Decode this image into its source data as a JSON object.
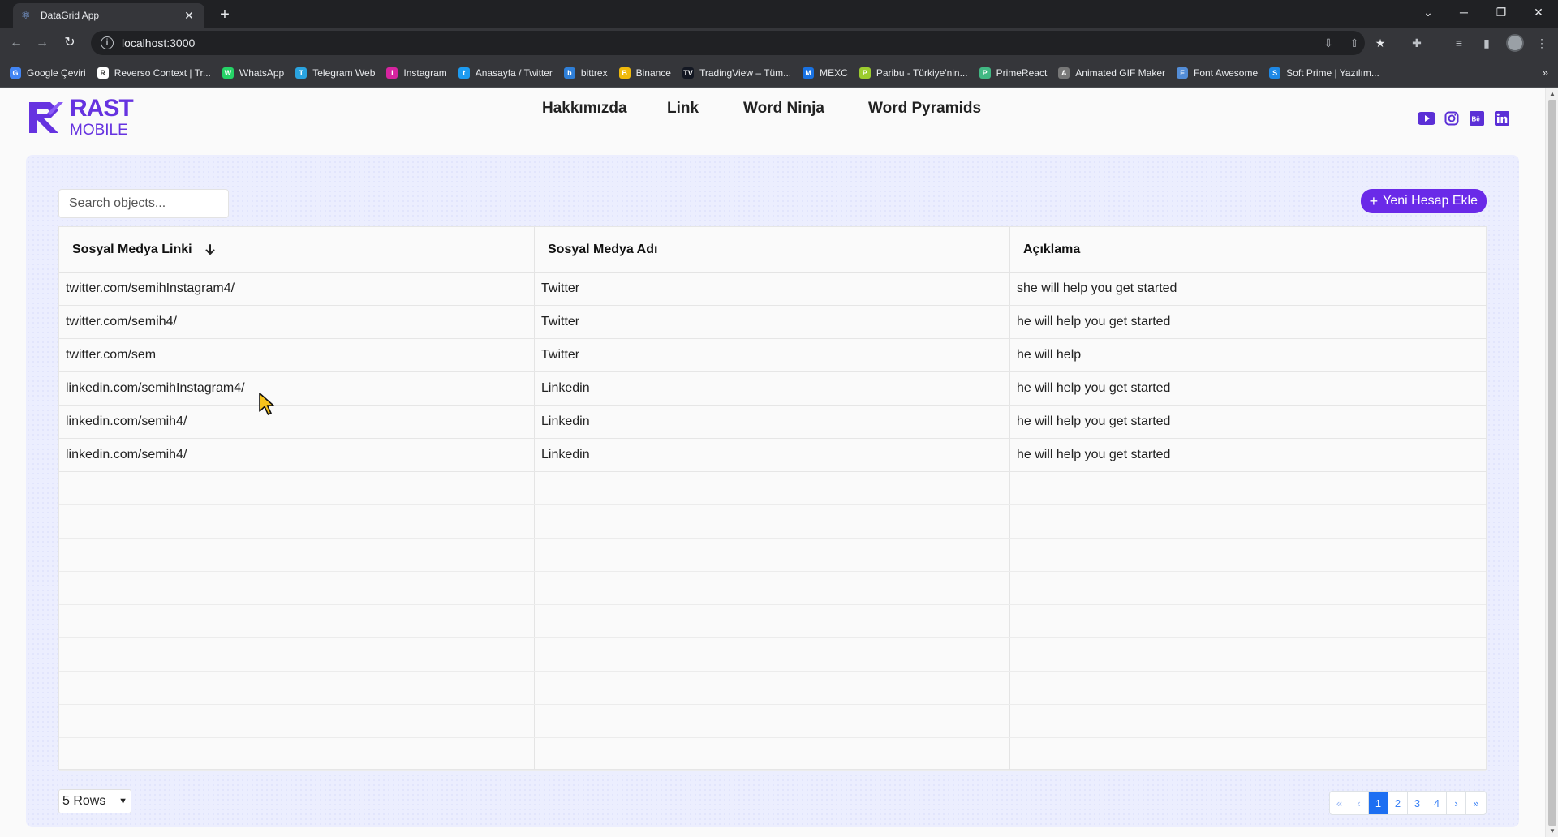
{
  "browser": {
    "tab_title": "DataGrid App",
    "url": "localhost:3000",
    "bookmarks": [
      {
        "label": "Google Çeviri",
        "color": "#4285f4",
        "glyph": "G"
      },
      {
        "label": "Reverso Context | Tr...",
        "color": "#ffffff",
        "glyph": "R"
      },
      {
        "label": "WhatsApp",
        "color": "#25d366",
        "glyph": "W"
      },
      {
        "label": "Telegram Web",
        "color": "#2aa3df",
        "glyph": "T"
      },
      {
        "label": "Instagram",
        "color": "#d6249f",
        "glyph": "I"
      },
      {
        "label": "Anasayfa / Twitter",
        "color": "#1d9bf0",
        "glyph": "t"
      },
      {
        "label": "bittrex",
        "color": "#2f7fd8",
        "glyph": "b"
      },
      {
        "label": "Binance",
        "color": "#f0b90b",
        "glyph": "B"
      },
      {
        "label": "TradingView – Tüm...",
        "color": "#131722",
        "glyph": "TV"
      },
      {
        "label": "MEXC",
        "color": "#1972e2",
        "glyph": "M"
      },
      {
        "label": "Paribu - Türkiye'nin...",
        "color": "#9ccc2e",
        "glyph": "P"
      },
      {
        "label": "PrimeReact",
        "color": "#41b883",
        "glyph": "P"
      },
      {
        "label": "Animated GIF Maker",
        "color": "#777777",
        "glyph": "A"
      },
      {
        "label": "Font Awesome",
        "color": "#538dd7",
        "glyph": "F"
      },
      {
        "label": "Soft Prime | Yazılım...",
        "color": "#1e88e5",
        "glyph": "S"
      }
    ]
  },
  "header": {
    "logo_line1": "RAST",
    "logo_line2": "MOBILE",
    "nav": [
      "Hakkımızda",
      "Link",
      "Word Ninja",
      "Word Pyramids"
    ],
    "socials": [
      "youtube-icon",
      "instagram-icon",
      "behance-icon",
      "linkedin-icon"
    ],
    "accent": "#6633e0"
  },
  "toolbar": {
    "search_placeholder": "Search objects...",
    "add_button_label": "Yeni Hesap Ekle",
    "add_button_color": "#6a2ae8"
  },
  "grid": {
    "columns": [
      "Sosyal Medya Linki",
      "Sosyal Medya Adı",
      "Açıklama"
    ],
    "sorted_column": "Sosyal Medya Linki",
    "sort_direction": "descending",
    "rows": [
      [
        "twitter.com/semihInstagram4/",
        "Twitter",
        "she will help you get started"
      ],
      [
        "twitter.com/semih4/",
        "Twitter",
        "he will help you get started"
      ],
      [
        "twitter.com/sem",
        "Twitter",
        "he will help"
      ],
      [
        "linkedin.com/semihInstagram4/",
        "Linkedin",
        "he will help you get started"
      ],
      [
        "linkedin.com/semih4/",
        "Linkedin",
        "he will help you get started"
      ],
      [
        "linkedin.com/semih4/",
        "Linkedin",
        "he will help you get started"
      ]
    ]
  },
  "footer": {
    "rows_per_page": "5 Rows",
    "pagination": {
      "first": "«",
      "prev": "‹",
      "pages": [
        "1",
        "2",
        "3",
        "4"
      ],
      "current": "1",
      "next": "›",
      "last": "»"
    }
  }
}
